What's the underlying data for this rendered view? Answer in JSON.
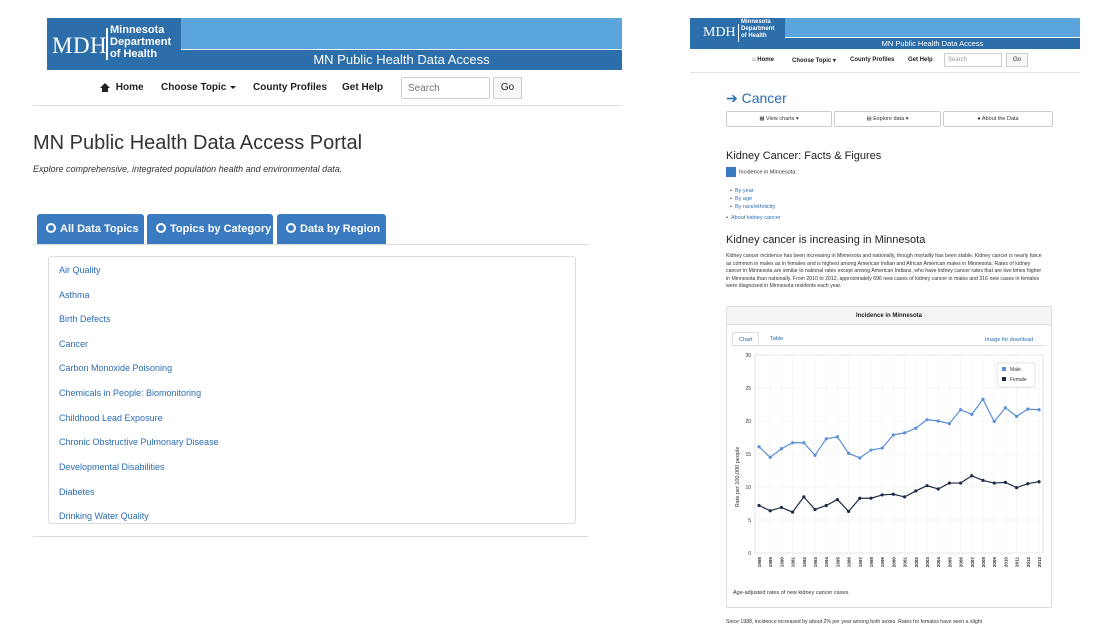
{
  "left": {
    "logo": {
      "abbr": "MDH",
      "dept": "Minnesota\nDepartment\nof Health"
    },
    "site_title": "MN Public Health Data Access",
    "nav": {
      "home": "Home",
      "choose_topic": "Choose Topic",
      "county_profiles": "County Profiles",
      "get_help": "Get Help",
      "search_placeholder": "Search",
      "go": "Go"
    },
    "page_title": "MN Public Health Data Access Portal",
    "subtitle": "Explore comprehensive, integrated population health and environmental data.",
    "tabs": [
      "All Data Topics",
      "Topics by Category",
      "Data by Region"
    ],
    "topics": [
      "Air Quality",
      "Asthma",
      "Birth Defects",
      "Cancer",
      "Carbon Monoxide Poisoning",
      "Chemicals in People: Biomonitoring",
      "Childhood Lead Exposure",
      "Chronic Obstructive Pulmonary Disease",
      "Developmental Disabilities",
      "Diabetes",
      "Drinking Water Quality"
    ]
  },
  "right": {
    "logo": {
      "abbr": "MDH",
      "dept": "Minnesota\nDepartment\nof Health"
    },
    "site_title": "MN Public Health Data Access",
    "nav": {
      "home": "Home",
      "choose_topic": "Choose Topic",
      "county_profiles": "County Profiles",
      "get_help": "Get Help",
      "search_placeholder": "Search",
      "go": "Go"
    },
    "page_heading": "Cancer",
    "buttons": [
      "View charts",
      "Explore data",
      "About the Data"
    ],
    "facts_title": "Kidney Cancer: Facts & Figures",
    "incidence_label": "Incidence in Minnesota:",
    "sub_links": [
      "By year",
      "By age",
      "By race/ethnicity"
    ],
    "about_link": "About kidney cancer",
    "section_title": "Kidney cancer is increasing in Minnesota",
    "paragraph": "Kidney cancer incidence has been increasing in Minnesota and nationally, though mortality has been stable. Kidney cancer is nearly twice as common in males as in females and is highest among American Indian and African American males in Minnesota. Rates of kidney cancer in Minnesota are similar to national rates except among American Indians, who have kidney cancer rates that are two times higher in Minnesota than nationally. From 2010 to 2012, approximately 696 new cases of kidney cancer in males and 316 new cases in females were diagnosed in Minnesota residents each year.",
    "chart_panel_title": "Incidence in Minnesota",
    "chart_tabs": [
      "Chart",
      "Table"
    ],
    "download_link": "Image for download",
    "caption": "Age-adjusted rates of new kidney cancer cases.",
    "bottom_text": "Since 1988, incidence increased by about 2% per year among both sexes. Rates for females have seen a slight"
  },
  "chart_data": {
    "type": "line",
    "title": "Incidence in Minnesota",
    "xlabel": "",
    "ylabel": "Rate per 100,000 people",
    "ylim": [
      0,
      30
    ],
    "yticks": [
      0,
      5,
      10,
      15,
      20,
      25,
      30
    ],
    "x": [
      "1988",
      "1989",
      "1990",
      "1991",
      "1992",
      "1993",
      "1994",
      "1995",
      "1996",
      "1997",
      "1998",
      "1999",
      "2000",
      "2001",
      "2002",
      "2003",
      "2004",
      "2005",
      "2006",
      "2007",
      "2008",
      "2009",
      "2010",
      "2011",
      "2012",
      "2013"
    ],
    "series": [
      {
        "name": "Male",
        "color": "#5b8fd6",
        "values": [
          16.1,
          14.5,
          15.8,
          16.7,
          16.7,
          14.8,
          17.3,
          17.6,
          15.1,
          14.4,
          15.6,
          15.9,
          17.9,
          18.2,
          18.9,
          20.2,
          20.0,
          19.6,
          21.7,
          21.0,
          23.3,
          19.9,
          22.0,
          20.7,
          21.8,
          21.7
        ]
      },
      {
        "name": "Female",
        "color": "#1e2b45",
        "values": [
          7.2,
          6.4,
          6.9,
          6.2,
          8.5,
          6.6,
          7.2,
          8.1,
          6.3,
          8.3,
          8.3,
          8.8,
          8.9,
          8.5,
          9.4,
          10.2,
          9.7,
          10.6,
          10.6,
          11.7,
          11.0,
          10.6,
          10.7,
          9.9,
          10.5,
          10.8
        ]
      }
    ],
    "grid": true,
    "legend_position": "top-right"
  }
}
